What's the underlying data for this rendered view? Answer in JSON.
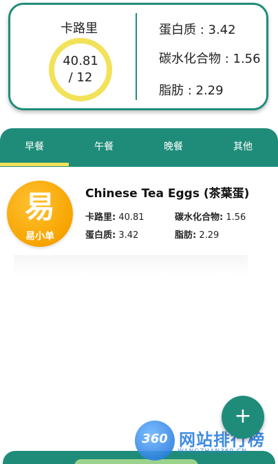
{
  "summary": {
    "calories_label": "卡路里",
    "calories_value_line1": "40.81",
    "calories_value_line2": "/ 12",
    "calories_progress": 1.0,
    "protein": "蛋白质 : 3.42",
    "carbs": "碳水化合物 : 1.56",
    "fat": "脂肪 : 2.29",
    "accent_color": "#1f8c7a",
    "ring_color": "#f2e25a"
  },
  "tabs": [
    {
      "label": "早餐",
      "selected": true
    },
    {
      "label": "午餐",
      "selected": false
    },
    {
      "label": "晚餐",
      "selected": false
    },
    {
      "label": "其他",
      "selected": false
    }
  ],
  "food_item": {
    "logo_glyph": "易",
    "logo_text": "易小单",
    "name": "Chinese Tea Eggs (茶葉蛋)",
    "calories_label": "卡路里:",
    "calories_value": "40.81",
    "carbs_label": "碳水化合物:",
    "carbs_value": "1.56",
    "protein_label": "蛋白质:",
    "protein_value": "3.42",
    "fat_label": "脂肪:",
    "fat_value": "2.29"
  },
  "fab": {
    "icon": "plus-icon",
    "label": "+"
  },
  "watermark": {
    "number": "360",
    "title": "网站排行榜",
    "subtitle": "WANGZHAN360.CN"
  }
}
